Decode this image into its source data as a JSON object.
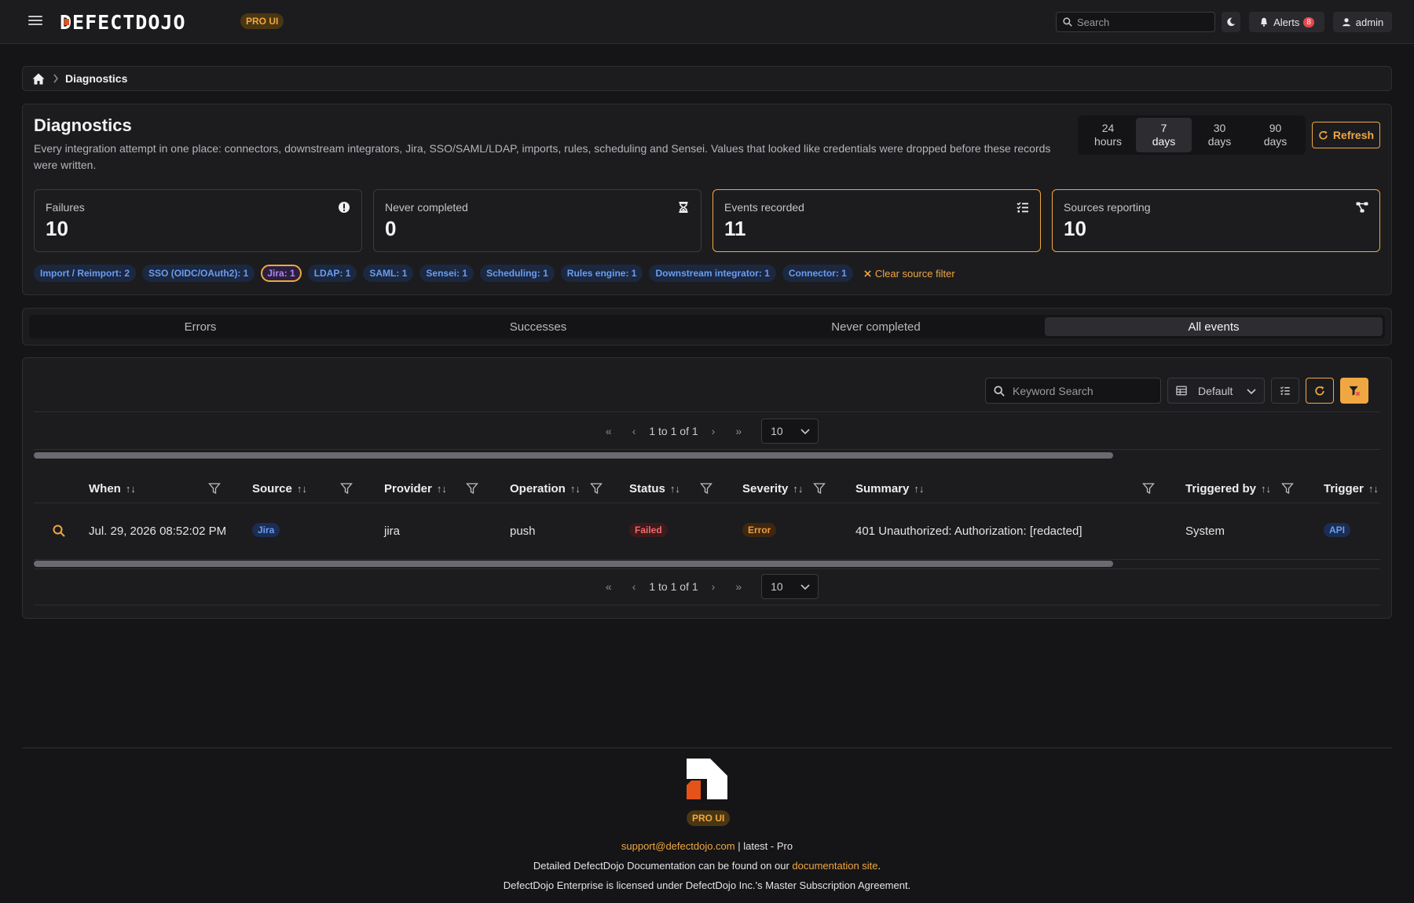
{
  "header": {
    "brand": "DEFECTDOJO",
    "pro_badge": "PRO UI",
    "search_placeholder": "Search",
    "alerts_label": "Alerts",
    "alerts_count": "8",
    "user_label": "admin"
  },
  "breadcrumb": {
    "current": "Diagnostics"
  },
  "page": {
    "title": "Diagnostics",
    "description": "Every integration attempt in one place: connectors, downstream integrators, Jira, SSO/SAML/LDAP, imports, rules, scheduling and Sensei. Values that looked like credentials were dropped before these records were written.",
    "ranges": [
      {
        "line1": "24",
        "line2": "hours"
      },
      {
        "line1": "7",
        "line2": "days"
      },
      {
        "line1": "30",
        "line2": "days"
      },
      {
        "line1": "90",
        "line2": "days"
      }
    ],
    "active_range": 1,
    "refresh_label": "Refresh"
  },
  "stats": [
    {
      "label": "Failures",
      "value": "10",
      "icon": "exclamation-circle-icon"
    },
    {
      "label": "Never completed",
      "value": "0",
      "icon": "hourglass-icon"
    },
    {
      "label": "Events recorded",
      "value": "11",
      "icon": "list-check-icon"
    },
    {
      "label": "Sources reporting",
      "value": "10",
      "icon": "share-nodes-icon"
    }
  ],
  "source_chips": [
    "Import / Reimport: 2",
    "SSO (OIDC/OAuth2): 1",
    "Jira: 1",
    "LDAP: 1",
    "SAML: 1",
    "Sensei: 1",
    "Scheduling: 1",
    "Rules engine: 1",
    "Downstream integrator: 1",
    "Connector: 1"
  ],
  "selected_chip": "Jira: 1",
  "clear_filter_label": "Clear source filter",
  "tabs": [
    "Errors",
    "Successes",
    "Never completed",
    "All events"
  ],
  "active_tab": "All events",
  "table": {
    "keyword_placeholder": "Keyword Search",
    "view_label": "Default",
    "pagination_text": "1 to 1 of 1",
    "page_size": "10",
    "columns": [
      "When",
      "Source",
      "Provider",
      "Operation",
      "Status",
      "Severity",
      "Summary",
      "Triggered by",
      "Trigger"
    ],
    "rows": [
      {
        "when": "Jul. 29, 2026 08:52:02 PM",
        "source": "Jira",
        "provider": "jira",
        "operation": "push",
        "status": "Failed",
        "severity": "Error",
        "summary": "401 Unauthorized: Authorization: [redacted]",
        "triggered_by": "System",
        "trigger": "API"
      }
    ]
  },
  "footer": {
    "pro_badge": "PRO UI",
    "support_email": "support@defectdojo.com",
    "version": " | latest - Pro",
    "docs_prefix": "Detailed DefectDojo Documentation can be found on our ",
    "docs_link": "documentation site",
    "docs_suffix": ".",
    "license": "DefectDojo Enterprise is licensed under DefectDojo Inc.'s Master Subscription Agreement."
  },
  "colors": {
    "accent": "#f0a742",
    "background": "#151517",
    "surface": "#1c1c1f",
    "chip_blue": "#6b9cf0",
    "status_failed": "#f06b6b",
    "severity_error": "#f09a42"
  }
}
